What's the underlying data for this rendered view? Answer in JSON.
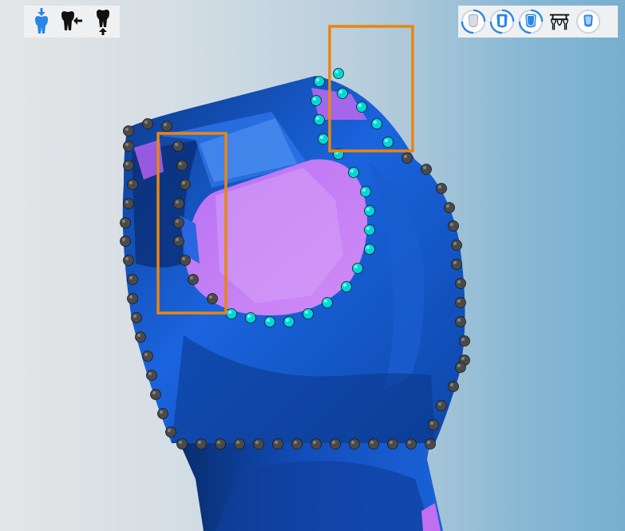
{
  "app": {
    "view": "dental-3d-margin-editor"
  },
  "toolbar_left": {
    "tools": [
      {
        "name": "tooth-insert-icon",
        "active": true
      },
      {
        "name": "tooth-arrow-left-icon",
        "active": false
      },
      {
        "name": "tooth-arrow-down-icon",
        "active": false
      }
    ]
  },
  "toolbar_right": {
    "tools": [
      {
        "name": "crown-outline-icon"
      },
      {
        "name": "crown-inner-icon"
      },
      {
        "name": "crown-solid-icon"
      },
      {
        "name": "bridge-icon"
      },
      {
        "name": "crown-grey-icon"
      }
    ]
  },
  "colors": {
    "model_blue": "#1565e0",
    "model_dark": "#0a2c6e",
    "prep_magenta": "#c87cf5",
    "margin_point_grey": "#4a4a4a",
    "margin_point_cyan": "#00d8d8",
    "highlight_box": "#e8860f",
    "accent": "#2a86e8"
  }
}
